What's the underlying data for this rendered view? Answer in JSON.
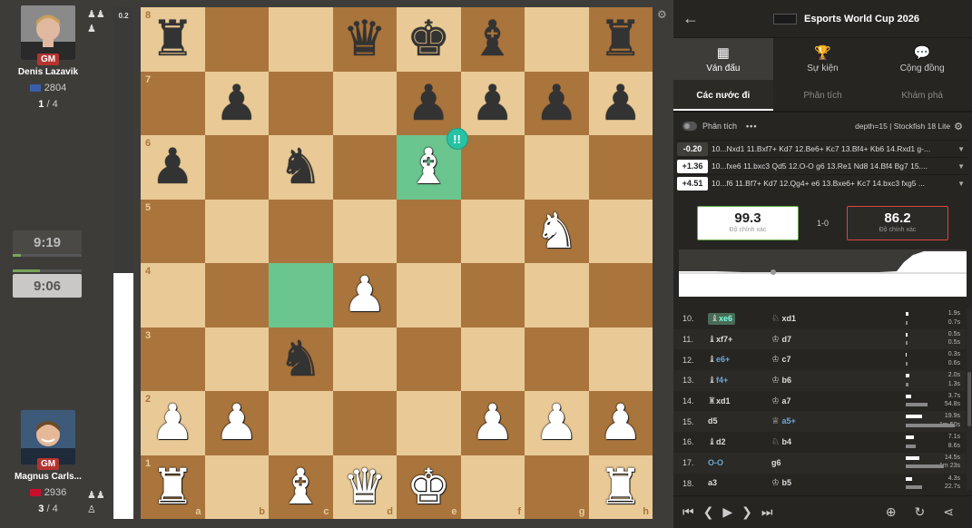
{
  "top_player": {
    "title": "GM",
    "name": "Denis Lazavik",
    "rating": "2804",
    "score": "1",
    "score_total": "/ 4",
    "flag_color": "#3a5ea8"
  },
  "bottom_player": {
    "title": "GM",
    "name": "Magnus Carls...",
    "rating": "2936",
    "score": "3",
    "score_total": "/ 4",
    "flag_color": "#c8102e"
  },
  "clocks": {
    "top": "9:19",
    "bottom": "9:06",
    "top_fraction": 0.12,
    "bottom_fraction": 0.4
  },
  "eval_bar": {
    "label": "0.2",
    "white_fraction": 0.48
  },
  "board": {
    "ranks": [
      "8",
      "7",
      "6",
      "5",
      "4",
      "3",
      "2",
      "1"
    ],
    "files": [
      "a",
      "b",
      "c",
      "d",
      "e",
      "f",
      "g",
      "h"
    ],
    "rows": [
      [
        "bR",
        "",
        "",
        "bQ",
        "bK",
        "bB",
        "",
        "bR"
      ],
      [
        "",
        "bP",
        "",
        "",
        "bP",
        "bP",
        "bP",
        "bP"
      ],
      [
        "bP",
        "",
        "bN",
        "",
        "wB",
        "",
        "",
        ""
      ],
      [
        "",
        "",
        "",
        "",
        "",
        "",
        "wN",
        ""
      ],
      [
        "",
        "",
        "",
        "wP",
        "",
        "",
        "",
        ""
      ],
      [
        "",
        "",
        "bN",
        "",
        "",
        "",
        "",
        ""
      ],
      [
        "wP",
        "wP",
        "",
        "",
        "",
        "wP",
        "wP",
        "wP"
      ],
      [
        "wR",
        "",
        "wB",
        "wQ",
        "wK",
        "",
        "",
        "wR"
      ]
    ],
    "highlight": [
      "e6",
      "c4"
    ],
    "brilliant_square": "e6",
    "brilliant_label": "!!"
  },
  "panel": {
    "title": "Esports World Cup 2026",
    "nav_tabs": [
      "Ván đấu",
      "Sự kiện",
      "Cộng đồng"
    ],
    "sub_tabs": [
      "Các nước đi",
      "Phân tích",
      "Khám phá"
    ],
    "analysis_label": "Phân tích",
    "engine": "depth=15 | Stockfish 18 Lite",
    "lines": [
      {
        "eval": "-0.20",
        "text": "10...Nxd1 11.Bxf7+ Kd7 12.Be6+ Kc7 13.Bf4+ Kb6 14.Rxd1 g-..."
      },
      {
        "eval": "+1.36",
        "text": "10...fxe6 11.bxc3 Qd5 12.O-O g6 13.Re1 Nd8 14.Bf4 Bg7 15...."
      },
      {
        "eval": "+4.51",
        "text": "10...f6 11.Bf7+ Kd7 12.Qg4+ e6 13.Bxe6+ Kc7 14.bxc3 fxg5 ..."
      }
    ],
    "accuracy_white": "99.3",
    "accuracy_black": "86.2",
    "accuracy_label": "Độ chính xác",
    "result": "1-0"
  },
  "moves": [
    {
      "n": "10.",
      "w": "xe6",
      "wp": "♝",
      "wsel": true,
      "b": "xd1",
      "bp": "♘",
      "t": [
        "1.9s",
        "0.7s"
      ]
    },
    {
      "n": "11.",
      "w": "xf7+",
      "wp": "♝",
      "b": "d7",
      "bp": "♔",
      "t": [
        "0.5s",
        "0.5s"
      ]
    },
    {
      "n": "12.",
      "w": "e6+",
      "wp": "♝",
      "wblue": true,
      "b": "c7",
      "bp": "♔",
      "t": [
        "0.3s",
        "0.6s"
      ]
    },
    {
      "n": "13.",
      "w": "f4+",
      "wp": "♝",
      "wblue": true,
      "b": "b6",
      "bp": "♔",
      "t": [
        "2.0s",
        "1.3s"
      ]
    },
    {
      "n": "14.",
      "w": "xd1",
      "wp": "♜",
      "b": "a7",
      "bp": "♔",
      "t": [
        "3.7s",
        "54.8s"
      ]
    },
    {
      "n": "15.",
      "w": "d5",
      "wp": "",
      "b": "a5+",
      "bp": "♕",
      "bblue": true,
      "t": [
        "19.9s",
        "1m 50s"
      ]
    },
    {
      "n": "16.",
      "w": "d2",
      "wp": "♝",
      "b": "b4",
      "bp": "♘",
      "t": [
        "7.1s",
        "8.6s"
      ]
    },
    {
      "n": "17.",
      "w": "O-O",
      "wp": "",
      "wblue": true,
      "b": "g6",
      "bp": "",
      "t": [
        "14.5s",
        "1m 23s"
      ]
    },
    {
      "n": "18.",
      "w": "a3",
      "wp": "",
      "b": "b5",
      "bp": "♔",
      "t": [
        "4.3s",
        "22.7s"
      ]
    }
  ],
  "time_fractions": [
    [
      0.05,
      0.03
    ],
    [
      0.03,
      0.03
    ],
    [
      0.02,
      0.03
    ],
    [
      0.06,
      0.05
    ],
    [
      0.1,
      0.4
    ],
    [
      0.3,
      0.9
    ],
    [
      0.15,
      0.18
    ],
    [
      0.25,
      0.7
    ],
    [
      0.12,
      0.3
    ]
  ]
}
